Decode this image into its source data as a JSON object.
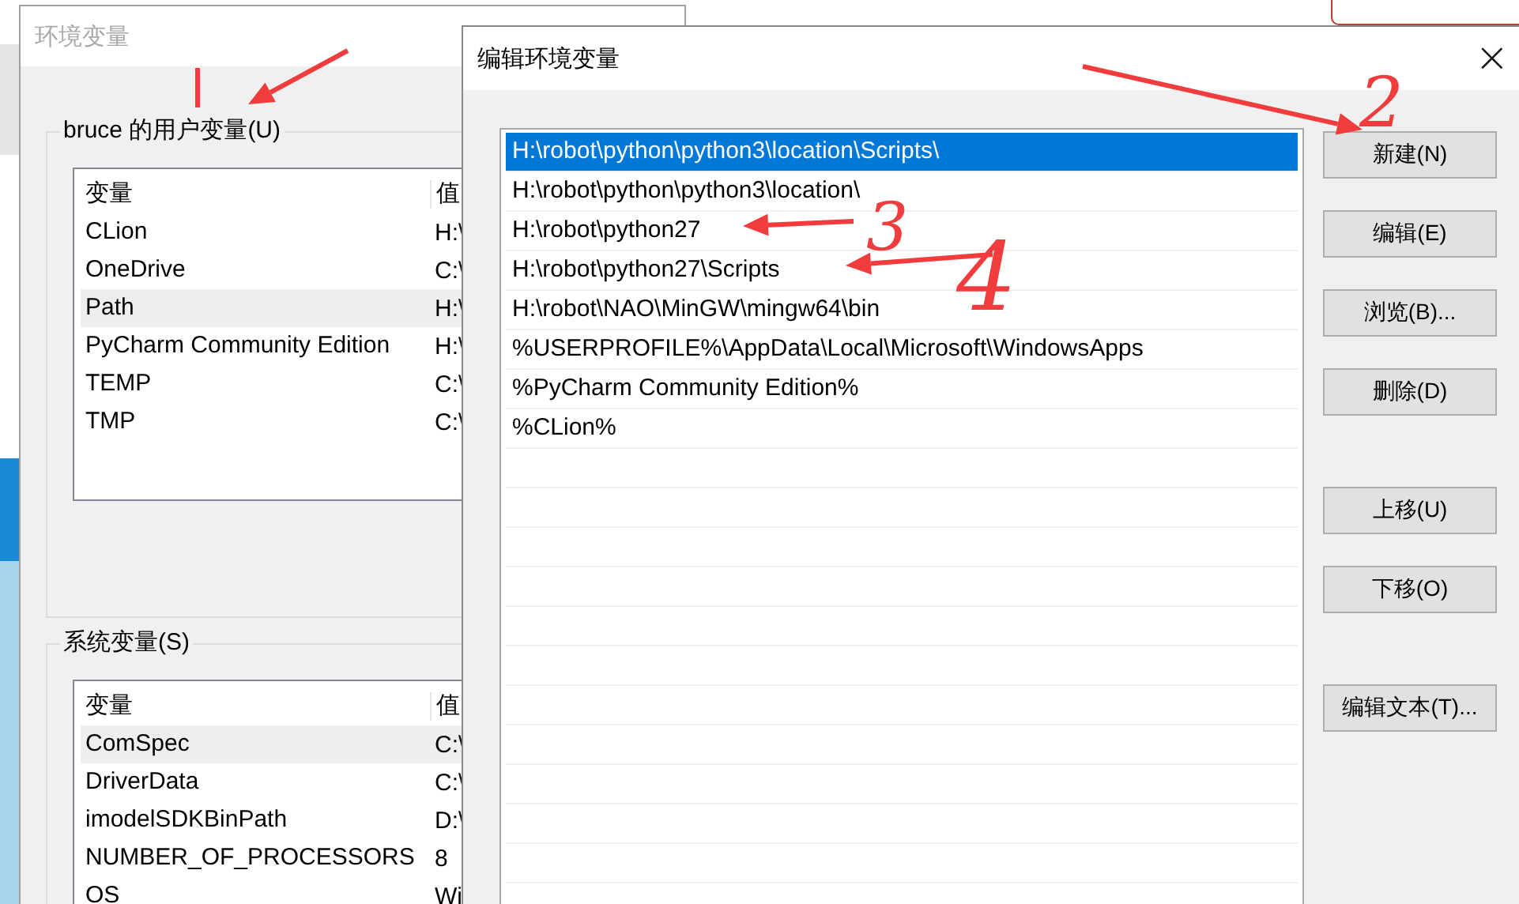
{
  "back_window": {
    "title": "环境变量",
    "user_group": {
      "label": "bruce 的用户变量(U)",
      "columns": [
        "变量",
        "值"
      ],
      "rows": [
        {
          "name": "CLion",
          "value": "H:\\",
          "selected": false
        },
        {
          "name": "OneDrive",
          "value": "C:\\",
          "selected": false
        },
        {
          "name": "Path",
          "value": "H:\\",
          "selected": true
        },
        {
          "name": "PyCharm Community Edition",
          "value": "H:\\",
          "selected": false
        },
        {
          "name": "TEMP",
          "value": "C:\\",
          "selected": false
        },
        {
          "name": "TMP",
          "value": "C:\\",
          "selected": false
        }
      ]
    },
    "system_group": {
      "label": "系统变量(S)",
      "columns": [
        "变量",
        "值"
      ],
      "rows": [
        {
          "name": "ComSpec",
          "value": "C:\\",
          "selected": true
        },
        {
          "name": "DriverData",
          "value": "C:\\",
          "selected": false
        },
        {
          "name": "imodelSDKBinPath",
          "value": "D:\\",
          "selected": false
        },
        {
          "name": "NUMBER_OF_PROCESSORS",
          "value": "8",
          "selected": false
        },
        {
          "name": "OS",
          "value": "Wi",
          "selected": false
        }
      ]
    }
  },
  "dialog": {
    "title": "编辑环境变量",
    "close": "×",
    "paths": [
      {
        "text": "H:\\robot\\python\\python3\\location\\Scripts\\",
        "selected": true
      },
      {
        "text": "H:\\robot\\python\\python3\\location\\",
        "selected": false
      },
      {
        "text": "H:\\robot\\python27",
        "selected": false
      },
      {
        "text": "H:\\robot\\python27\\Scripts",
        "selected": false
      },
      {
        "text": "H:\\robot\\NAO\\MinGW\\mingw64\\bin",
        "selected": false
      },
      {
        "text": "%USERPROFILE%\\AppData\\Local\\Microsoft\\WindowsApps",
        "selected": false
      },
      {
        "text": "%PyCharm Community Edition%",
        "selected": false
      },
      {
        "text": "%CLion%",
        "selected": false
      }
    ],
    "button_groups": [
      [
        "新建(N)",
        "编辑(E)",
        "浏览(B)...",
        "删除(D)"
      ],
      [
        "上移(U)",
        "下移(O)"
      ],
      [
        "编辑文本(T)..."
      ]
    ]
  },
  "annotations": [
    {
      "label": "2"
    },
    {
      "label": "3"
    },
    {
      "label": "4"
    }
  ]
}
